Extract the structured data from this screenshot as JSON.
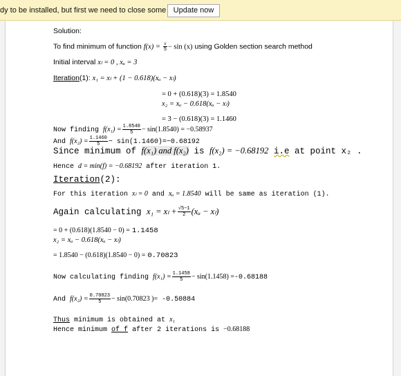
{
  "notification": {
    "message": "dy to be installed, but first we need to close some apps.",
    "button": "Update now"
  },
  "doc": {
    "l1": "Solution:",
    "l2_prefix": "To find minimum of function",
    "l2_func": "f(x) =",
    "l2_frac_num": "x",
    "l2_frac_den": "5",
    "l2_tail": "− sin (x)",
    "l2_suffix": "using Golden section search method",
    "l3_prefix": "Initial interval",
    "l3_math": "xₗ = 0 , xᵤ = 3",
    "l4_link": "Iteration",
    "l4_num": "(1):",
    "l4_math": "x₁ = xₗ + (1 − 0.618)(xᵤ − xₗ)",
    "l5": "= 0 + (0.618)(3) = 1.8540",
    "l6": "x₂ = xᵤ − 0.618(xᵤ − xₗ)",
    "l7": "= 3 − (0.618)(3) = 1.1460",
    "l8_prefix": "Now finding",
    "l8_func": "f(x₁) =",
    "l8_num": "1.8540",
    "l8_den": "5",
    "l8_tail": "− sin(1.8540) = −0.58937",
    "l9_prefix": "And",
    "l9_func": "f(x₂) =",
    "l9_num": "1.1460",
    "l9_den": "5",
    "l9_tail": "− sin(1.1460)=−0.68192",
    "l10_a": "Since minimum of",
    "l10_hl": "f(x₁) and f(x₂)",
    "l10_b": "is",
    "l10_c": "f(x₂) = −0.68192",
    "l10_ie": "i.e",
    "l10_d": "at point x₂ .",
    "l11_a": "Hence",
    "l11_b": "d = min(f) = −0.68192",
    "l11_c": "after iteration 1.",
    "l12_link": "Iteration",
    "l12_num": "(2):",
    "l13_a": "For this iteration",
    "l13_b": "xₗ = 0",
    "l13_c": "and",
    "l13_d": "xᵤ = 1.8540",
    "l13_e": "will be same as iteration (1).",
    "l14_a": "Again calculating",
    "l14_b": "x₁ = xₗ +",
    "l14_num": "√5−1",
    "l14_den": "2",
    "l14_c": "(xᵤ − xₗ)",
    "l15_a": "= 0 + (0.618)(1.8540 − 0) =",
    "l15_b": "1.1458",
    "l16": "x₂ = xᵤ − 0.618(xᵤ − xₗ)",
    "l17_a": "= 1.8540 − (0.618)(1.8540 − 0) =",
    "l17_b": "0.70823",
    "l18_a": "Now calculating finding",
    "l18_func": "f(x₁) =",
    "l18_num": "1.1458",
    "l18_den": "5",
    "l18_tail": "− sin(1.1458) =",
    "l18_val": "-0.68188",
    "l19_a": "And",
    "l19_func": "f(x₂) =",
    "l19_num": "0.70823",
    "l19_den": "5",
    "l19_tail": "− sin(0.70823 )=",
    "l19_val": "-0.50884",
    "l20_a": "Thus",
    "l20_b": "minimum is obtained at",
    "l20_c": "x₁",
    "l21_a": "Hence minimum",
    "l21_of": "of f",
    "l21_b": "after 2 iterations is",
    "l21_c": "−0.68188"
  }
}
